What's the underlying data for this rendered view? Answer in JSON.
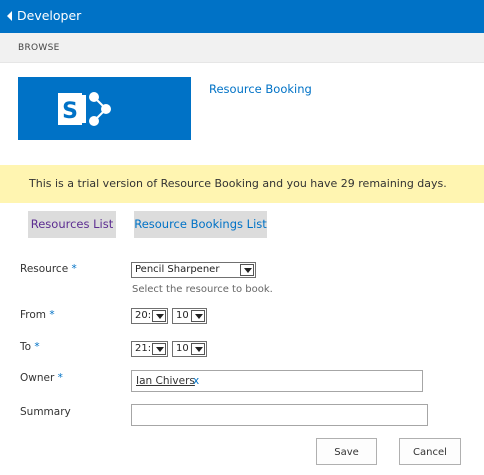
{
  "header": {
    "title": "Developer",
    "back_icon": "back-arrow-icon"
  },
  "ribbon": {
    "tab": "BROWSE"
  },
  "app": {
    "logo_icon": "sharepoint-logo-icon",
    "link": "Resource Booking"
  },
  "banner": {
    "text": "This is a trial version of Resource Booking and you have 29 remaining days."
  },
  "nav": {
    "resources_list": "Resources List",
    "resource_bookings_list": "Resource Bookings List"
  },
  "form": {
    "resource": {
      "label": "Resource",
      "required": "*",
      "value": "Pencil Sharpener",
      "hint": "Select the resource to book."
    },
    "from": {
      "label": "From",
      "required": "*",
      "hour": "20:",
      "minute": "10"
    },
    "to": {
      "label": "To",
      "required": "*",
      "hour": "21:",
      "minute": "10"
    },
    "owner": {
      "label": "Owner",
      "required": "*",
      "value": "Ian Chivers",
      "remove": "x"
    },
    "summary": {
      "label": "Summary",
      "value": ""
    }
  },
  "buttons": {
    "save": "Save",
    "cancel": "Cancel"
  },
  "colors": {
    "accent": "#0072c6",
    "banner": "#fff5b1",
    "visited_link": "#5c2d91"
  }
}
